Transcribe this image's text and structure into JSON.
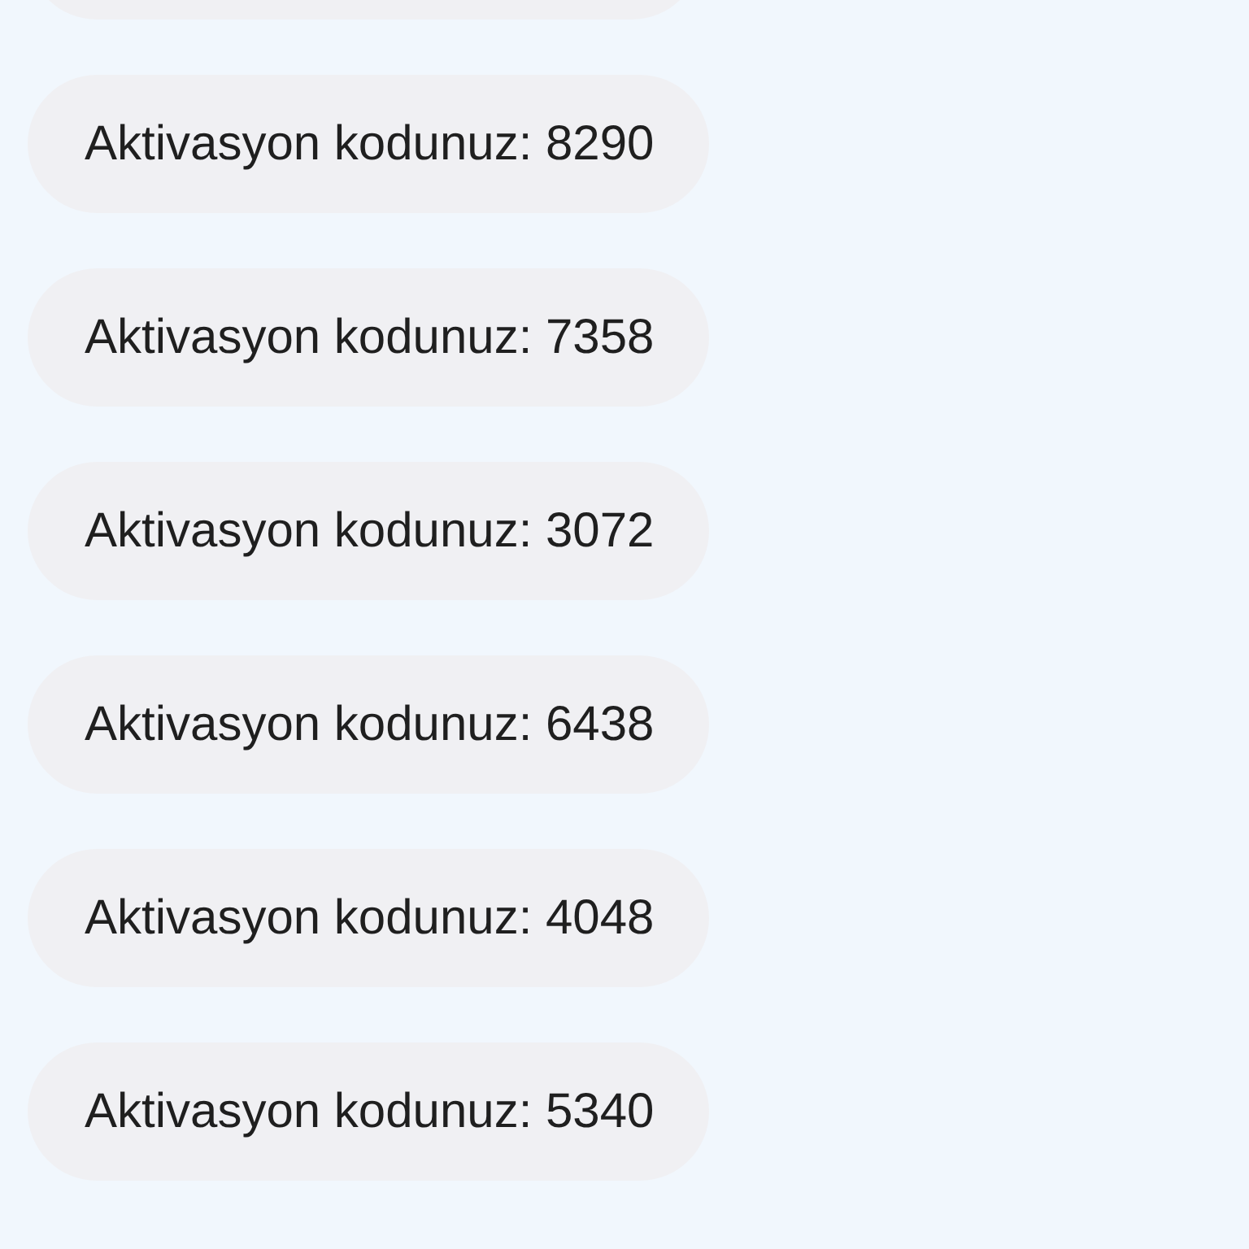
{
  "messages": [
    {
      "kind": "clipped"
    },
    {
      "kind": "text",
      "text": "Aktivasyon kodunuz: 8290"
    },
    {
      "kind": "text",
      "text": "Aktivasyon kodunuz: 7358"
    },
    {
      "kind": "text",
      "text": "Aktivasyon kodunuz: 3072"
    },
    {
      "kind": "text",
      "text": "Aktivasyon kodunuz: 6438"
    },
    {
      "kind": "text",
      "text": "Aktivasyon kodunuz: 4048"
    },
    {
      "kind": "text",
      "text": "Aktivasyon kodunuz: 5340"
    }
  ]
}
